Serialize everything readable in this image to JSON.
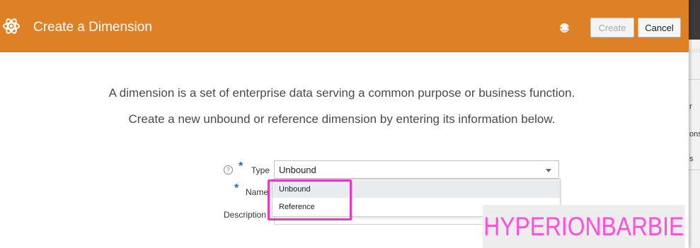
{
  "background_app": {
    "fragments": [
      "omy",
      "r",
      "ons",
      "s"
    ]
  },
  "dialog": {
    "title": "Create a Dimension",
    "icon": "atom-icon",
    "help_icon": "help-icon",
    "create_button": "Create",
    "cancel_button": "Cancel",
    "intro_line_1": "A dimension is a set of enterprise data serving a common purpose or business function.",
    "intro_line_2": "Create a new unbound or reference dimension by entering its information below."
  },
  "form": {
    "type_label": "Type",
    "type_value": "Unbound",
    "name_label": "Name",
    "description_label": "Description",
    "required_marker": "*",
    "type_options": [
      "Unbound",
      "Reference"
    ]
  },
  "watermark": "HYPERIONBARBIE",
  "colors": {
    "header": "#de8126",
    "highlight": "#e639c7",
    "required": "#1a6ab8",
    "watermark": "#ff4fd8"
  }
}
